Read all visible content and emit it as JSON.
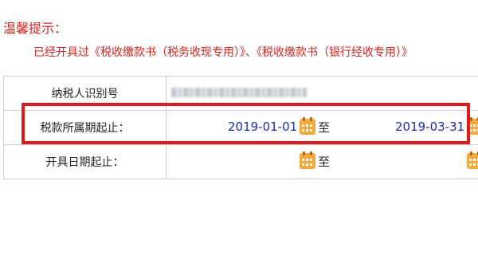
{
  "notice": {
    "title": "温馨提示：",
    "text": "已经开具过《税收缴款书（税务收现专用）》、《税收缴款书（银行经收专用）》"
  },
  "form": {
    "taxpayer_id_label": "纳税人识别号",
    "tax_period_label": "税款所属期起止：",
    "tax_period_start": "2019-01-01",
    "tax_period_end": "2019-03-31",
    "to_text": "至",
    "issue_date_label": "开具日期起止：",
    "issue_date_start": "",
    "issue_date_end": ""
  },
  "icons": {
    "calendar": "calendar-icon"
  },
  "colors": {
    "notice_red": "#d2241e",
    "date_blue": "#1a2fb0",
    "highlight_red": "#e01b1b",
    "calendar_orange": "#f3a93b"
  }
}
